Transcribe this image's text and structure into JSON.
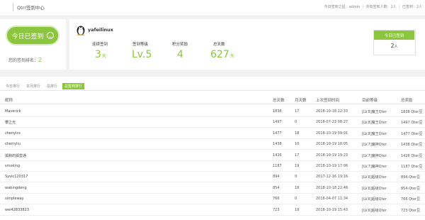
{
  "topbar": {
    "title": "Qtrr签到中心",
    "right_text": "今日签到之星：admin ｜ 共有签到人数：2人 ｜ 已签到：2人"
  },
  "checkin": {
    "button_label": "今日已签到",
    "rank_label": "您的签到排名：",
    "rank_value": "2"
  },
  "user": {
    "name": "yafeilinux",
    "stats": [
      {
        "label": "连续签到",
        "value": "3",
        "unit": "天"
      },
      {
        "label": "签到等级",
        "value": "Lv.5",
        "unit": ""
      },
      {
        "label": "积分奖励",
        "value": "4",
        "unit": ""
      },
      {
        "label": "总天数",
        "value": "627",
        "unit": "天"
      }
    ]
  },
  "today": {
    "header": "今日已签到",
    "value": "2",
    "unit": "人"
  },
  "tabs": [
    "今日排行",
    "本月排行",
    "总排行",
    "总签到排行"
  ],
  "table": {
    "headers": [
      "昵称",
      "总天数",
      "月天数",
      "上次签到时间",
      "目前等级",
      "总奖励"
    ],
    "rows": [
      [
        "Maverick",
        "1838",
        "17",
        "2018-10-18 22:33",
        "[LV.8]魔王Qter",
        "1838 Qter豆"
      ],
      [
        "攀之光",
        "1497",
        "0",
        "2018-07-23 08:27",
        "[LV.8]魔王Qter",
        "1497 Qter豆"
      ],
      [
        "chenyics",
        "1477",
        "18",
        "2018-10-19 09:01",
        "[LV.8]魔王Qter",
        "1477 Qter豆"
      ],
      [
        "cherryliu",
        "1438",
        "10",
        "2018-10-19 18:05",
        "[LV.7]魔神Qter",
        "1438 Qter豆"
      ],
      [
        "狐默的狐蛮通",
        "1426",
        "17",
        "2018-10-19 19:23",
        "[LV.7]魔神Qter",
        "1426 Qter豆"
      ],
      [
        "smoking",
        "1187",
        "19",
        "2018-10-19 17:06",
        "[LV.7]魔神Qter",
        "1187 Qter豆"
      ],
      [
        "Syvic120317",
        "894",
        "0",
        "2017-12-16 19:16",
        "[LV.6]超级Qter",
        "894 Qter豆"
      ],
      [
        "wabingdeng",
        "854",
        "18",
        "2018-10-18 22:48",
        "[LV.6]超级Qter",
        "854 Qter豆"
      ],
      [
        "simpleway",
        "766",
        "0",
        "2018-04-07 11:34",
        "[LV.6]超级Qter",
        "766 Qter豆"
      ],
      [
        "wei42833823",
        "723",
        "19",
        "2018-10-19 15:43",
        "[LV.6]超级Qter",
        "723 Qter豆"
      ]
    ]
  },
  "colors": {
    "accent": "#8cc63f"
  }
}
